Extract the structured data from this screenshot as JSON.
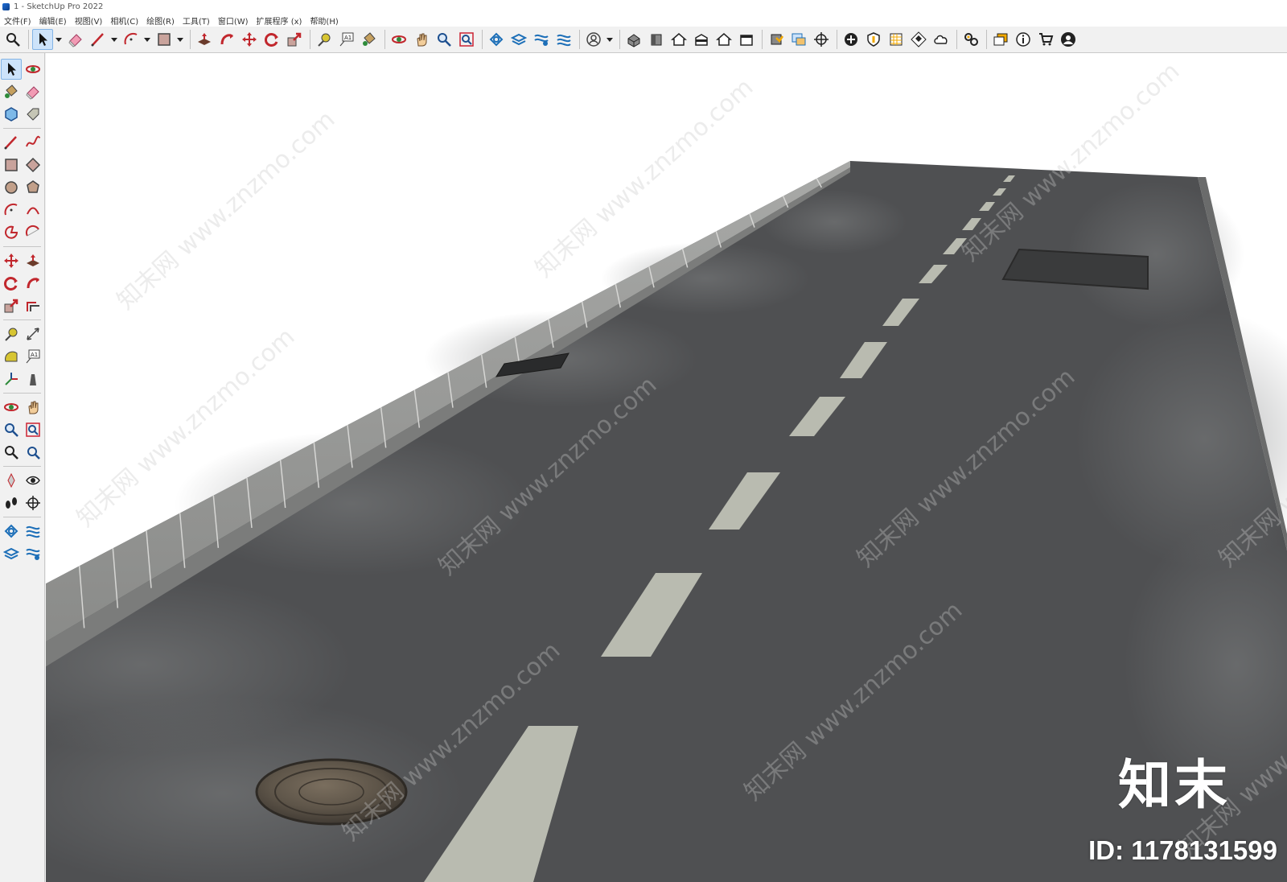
{
  "window": {
    "title": "1 - SketchUp Pro 2022"
  },
  "menu": [
    "文件(F)",
    "编辑(E)",
    "视图(V)",
    "相机(C)",
    "绘图(R)",
    "工具(T)",
    "窗口(W)",
    "扩展程序 (x)",
    "帮助(H)"
  ],
  "toolbar": {
    "active_tool": "select",
    "groups": [
      [
        "zoom-extents-icon"
      ],
      [
        "select-icon",
        "dropdown",
        "eraser-icon",
        "line-icon",
        "dropdown",
        "arc-icon",
        "dropdown",
        "rectangle-icon",
        "dropdown"
      ],
      [
        "push-pull-icon",
        "follow-me-icon",
        "move-icon",
        "rotate-icon",
        "scale-icon"
      ],
      [
        "tape-measure-icon",
        "text-icon",
        "paint-bucket-icon"
      ],
      [
        "orbit-icon",
        "pan-icon",
        "zoom-icon",
        "zoom-window-icon"
      ],
      [
        "sandbox-icon",
        "smoove-icon",
        "stamp-icon",
        "flip-edge-icon"
      ],
      [
        "account-icon",
        "dropdown"
      ],
      [
        "iso-view-icon",
        "front-view-icon",
        "top-view-icon",
        "right-view-icon",
        "back-view-icon",
        "left-view-icon"
      ],
      [
        "solid-tools-icon",
        "outer-shell-icon",
        "section-plane-icon"
      ],
      [
        "add-location-icon",
        "shield-icon",
        "3d-warehouse-icon",
        "checker-icon",
        "cloud-icon"
      ],
      [
        "extension-manager-icon"
      ],
      [
        "layers-icon",
        "info-icon",
        "cart-icon",
        "profile-icon"
      ]
    ]
  },
  "left_toolbar": {
    "groups": [
      [
        [
          "select-icon",
          "orbit-icon"
        ],
        [
          "paint-bucket-icon",
          "eraser-icon"
        ],
        [
          "component-icon",
          "tag-icon"
        ]
      ],
      [
        [
          "line-icon",
          "freehand-icon"
        ],
        [
          "rectangle-icon",
          "rotated-rect-icon"
        ],
        [
          "circle-icon",
          "polygon-icon"
        ],
        [
          "arc-icon",
          "two-point-arc-icon"
        ],
        [
          "pie-icon",
          "three-point-arc-icon"
        ]
      ],
      [
        [
          "move-icon",
          "push-pull-icon"
        ],
        [
          "rotate-icon",
          "follow-me-icon"
        ],
        [
          "scale-icon",
          "offset-icon"
        ]
      ],
      [
        [
          "tape-measure-icon",
          "dimension-icon"
        ],
        [
          "protractor-icon",
          "text-icon"
        ],
        [
          "axes-icon",
          "3d-text-icon"
        ]
      ],
      [
        [
          "orbit-icon",
          "pan-icon"
        ],
        [
          "zoom-icon",
          "zoom-window-icon"
        ],
        [
          "zoom-extents-icon",
          "previous-view-icon"
        ]
      ],
      [
        [
          "position-camera-icon",
          "look-around-icon"
        ],
        [
          "walk-icon",
          "section-plane-icon"
        ]
      ],
      [
        [
          "sandbox-contours-icon",
          "sandbox-scratch-icon"
        ],
        [
          "smoove-icon",
          "stamp-icon"
        ]
      ]
    ]
  },
  "viewport": {
    "scene": "road-model",
    "sky_color": "#ffffff",
    "asphalt_color": "#4f5052",
    "lane_marking_color": "#b9bbb0",
    "curb_color": "#9a9b99"
  },
  "watermark": {
    "text": "知末网 www.znzmo.com",
    "brand": "知末",
    "id": "ID: 1178131599"
  }
}
